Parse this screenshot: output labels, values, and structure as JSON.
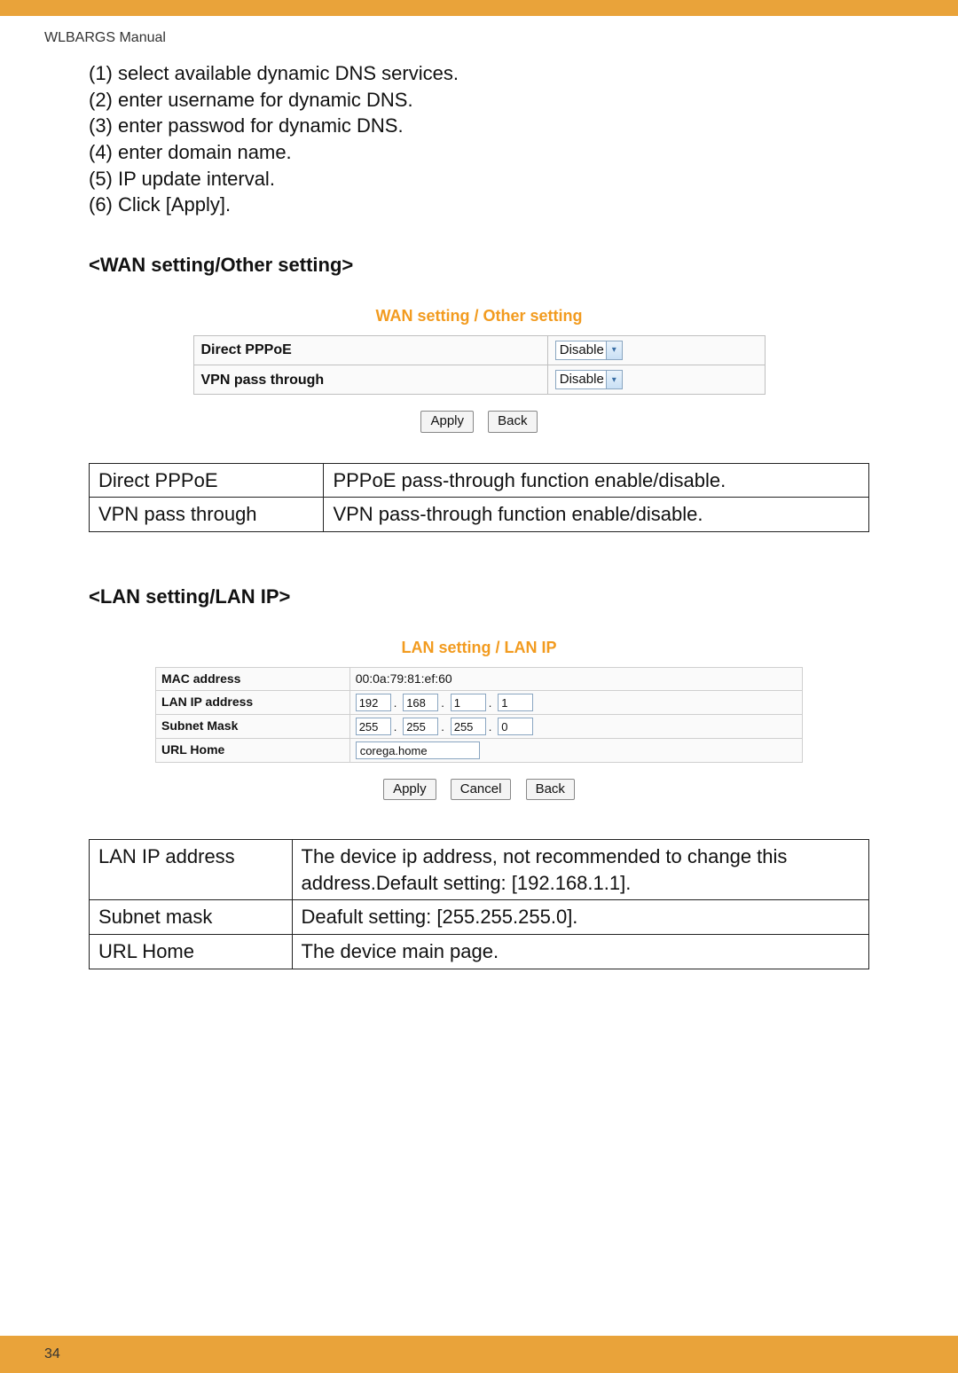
{
  "header": {
    "manual": "WLBARGS Manual"
  },
  "steps": [
    "(1) select available dynamic DNS services.",
    "(2) enter username for dynamic DNS.",
    "(3) enter passwod for dynamic DNS.",
    "(4) enter domain name.",
    "(5) IP update interval.",
    "(6) Click [Apply]."
  ],
  "wan": {
    "heading": "<WAN setting/Other setting>",
    "shot_title": "WAN setting / Other setting",
    "rows": [
      {
        "label": "Direct PPPoE",
        "value": "Disable"
      },
      {
        "label": "VPN pass through",
        "value": "Disable"
      }
    ],
    "buttons": {
      "apply": "Apply",
      "back": "Back"
    },
    "desc": [
      {
        "name": "Direct PPPoE",
        "text": "PPPoE pass-through function enable/disable."
      },
      {
        "name": "VPN pass through",
        "text": "VPN pass-through function enable/disable."
      }
    ]
  },
  "lan": {
    "heading": "<LAN setting/LAN IP>",
    "shot_title": "LAN setting / LAN IP",
    "mac_label": "MAC address",
    "mac_value": "00:0a:79:81:ef:60",
    "ip_label": "LAN IP address",
    "ip": [
      "192",
      "168",
      "1",
      "1"
    ],
    "mask_label": "Subnet Mask",
    "mask": [
      "255",
      "255",
      "255",
      "0"
    ],
    "url_label": "URL Home",
    "url_value": "corega.home",
    "buttons": {
      "apply": "Apply",
      "cancel": "Cancel",
      "back": "Back"
    },
    "desc": [
      {
        "name": "LAN IP address",
        "text": "The device ip address, not recommended to change this address.Default setting: [192.168.1.1]."
      },
      {
        "name": "Subnet mask",
        "text": "Deafult setting: [255.255.255.0]."
      },
      {
        "name": "URL Home",
        "text": "The device main page."
      }
    ]
  },
  "footer": {
    "page": "34"
  }
}
